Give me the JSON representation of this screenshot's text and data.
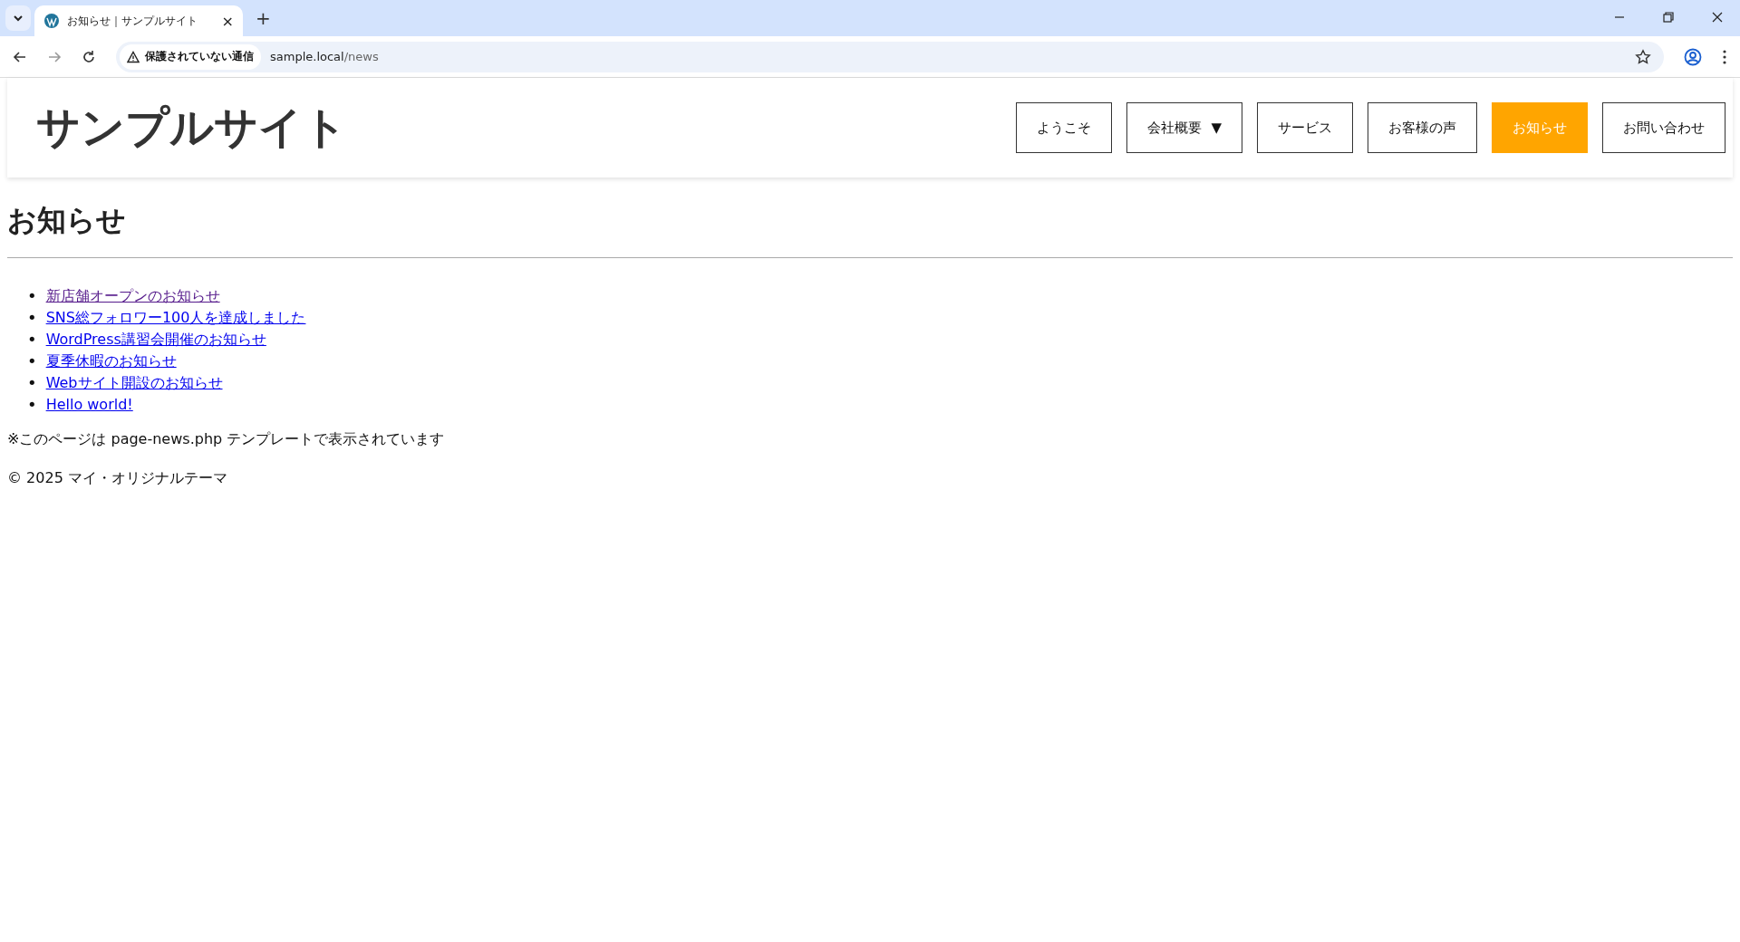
{
  "browser": {
    "tab": {
      "title": "お知らせ｜サンプルサイト",
      "close": "×"
    },
    "new_tab": "+",
    "security_label": "保護されていない通信",
    "url_host": "sample.local",
    "url_path": "/news"
  },
  "site": {
    "logo": "サンプルサイト",
    "nav": [
      {
        "label": "ようこそ",
        "selected": false
      },
      {
        "label": "会社概要",
        "selected": false,
        "caret": "▼"
      },
      {
        "label": "サービス",
        "selected": false
      },
      {
        "label": "お客様の声",
        "selected": false
      },
      {
        "label": "お知らせ",
        "selected": true
      },
      {
        "label": "お問い合わせ",
        "selected": false
      }
    ]
  },
  "page": {
    "title": "お知らせ",
    "posts": [
      {
        "bullet": "•",
        "title": "新店舗オープンのお知らせ",
        "visited": true
      },
      {
        "bullet": "•",
        "title": "SNS総フォロワー100人を達成しました",
        "visited": false
      },
      {
        "bullet": "•",
        "title": "WordPress講習会開催のお知らせ",
        "visited": false
      },
      {
        "bullet": "•",
        "title": "夏季休暇のお知らせ",
        "visited": false
      },
      {
        "bullet": "•",
        "title": "Webサイト開設のお知らせ",
        "visited": false
      },
      {
        "bullet": "•",
        "title": "Hello world!",
        "visited": false
      }
    ],
    "note": "※このページは page-news.php テンプレートで表示されています"
  },
  "footer": "© 2025 マイ・オリジナルテーマ"
}
